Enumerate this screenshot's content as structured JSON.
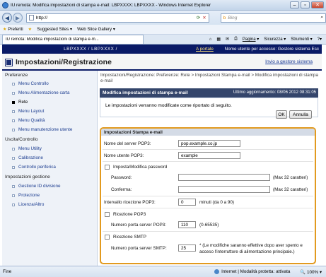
{
  "window": {
    "title": "IU remota: Modifica impostazioni di stampa e-mail: LBPXXXX: LBPXXXX - Windows Internet Explorer"
  },
  "browser": {
    "address": "http://",
    "search_placeholder": "Bing",
    "favorites_label": "Preferiti",
    "suggested_sites": "Suggested Sites",
    "web_slice_gallery": "Web Slice Gallery",
    "tab_label": "IU remota: Modifica impostazioni di stampa e-m...",
    "cmd_page": "Pagina",
    "cmd_security": "Sicurezza",
    "cmd_tools": "Strumenti"
  },
  "device_bar": {
    "model": "LBPXXXX / LBPXXXX /",
    "portal_link": "A portale",
    "user_label": "Nome utente per accesso: Gestore sistema Esc"
  },
  "header": {
    "title": "Impostazioni/Registrazione",
    "mail_link": "Invio a gestore sistema"
  },
  "sidebar": {
    "sections": [
      {
        "label": "Preferenze",
        "items": [
          "Menu Controllo",
          "Menu Alimentazione carta",
          "Rete",
          "Menu Layout",
          "Menu Qualità",
          "Menu manutenzione utente"
        ]
      },
      {
        "label": "Uscita/Controllo",
        "items": [
          "Menu Utility",
          "Calibrazione",
          "Controllo periferica"
        ]
      },
      {
        "label": "Impostazioni gestione",
        "items": [
          "Gestione ID divisione",
          "Protezione",
          "Licenza/Altro"
        ]
      }
    ],
    "selected": "Rete"
  },
  "breadcrumb": "Impostazioni/Registrazione: Preferenze: Rete > Impostazioni Stampa e-mail > Modifica impostazioni di stampa e-mail",
  "edit_panel": {
    "title": "Modifica impostazioni di stampa e-mail",
    "last_update": "Ultimo aggiornamento: 08/06 2012 08:31:05",
    "message": "Le impostazioni verranno modificate come riportato di seguito.",
    "ok": "OK",
    "cancel": "Annulla"
  },
  "form": {
    "section_title": "Impostazioni Stampa e-mail",
    "pop3_server_label": "Nome del server POP3:",
    "pop3_server_value": "pop.example.co.jp",
    "pop3_user_label": "Nome utente POP3:",
    "pop3_user_value": "example",
    "set_password_label": "Imposta/Modifica password",
    "password_label": "Password:",
    "password_hint": "(Max 32 caratteri)",
    "confirm_label": "Conferma:",
    "confirm_hint": "(Max 32 caratteri)",
    "interval_label": "Intervallo ricezione POP3:",
    "interval_value": "0",
    "interval_hint": "minuti (da 0 a 90)",
    "pop3_receive_label": "Ricezione POP3",
    "pop3_port_label": "Numero porta server POP3:",
    "pop3_port_value": "110",
    "pop3_port_hint": "(0-65535)",
    "smtp_receive_label": "Ricezione SMTP",
    "smtp_port_label": "Numero porta server SMTP:",
    "smtp_port_value": "25",
    "smtp_note": "* (Le modifiche saranno effettive dopo aver spento e acceso l'interruttore di alimentazione principale.)"
  },
  "statusbar": {
    "left": "Fine",
    "zone": "Internet | Modalità protetta: attivata",
    "zoom": "100%"
  }
}
